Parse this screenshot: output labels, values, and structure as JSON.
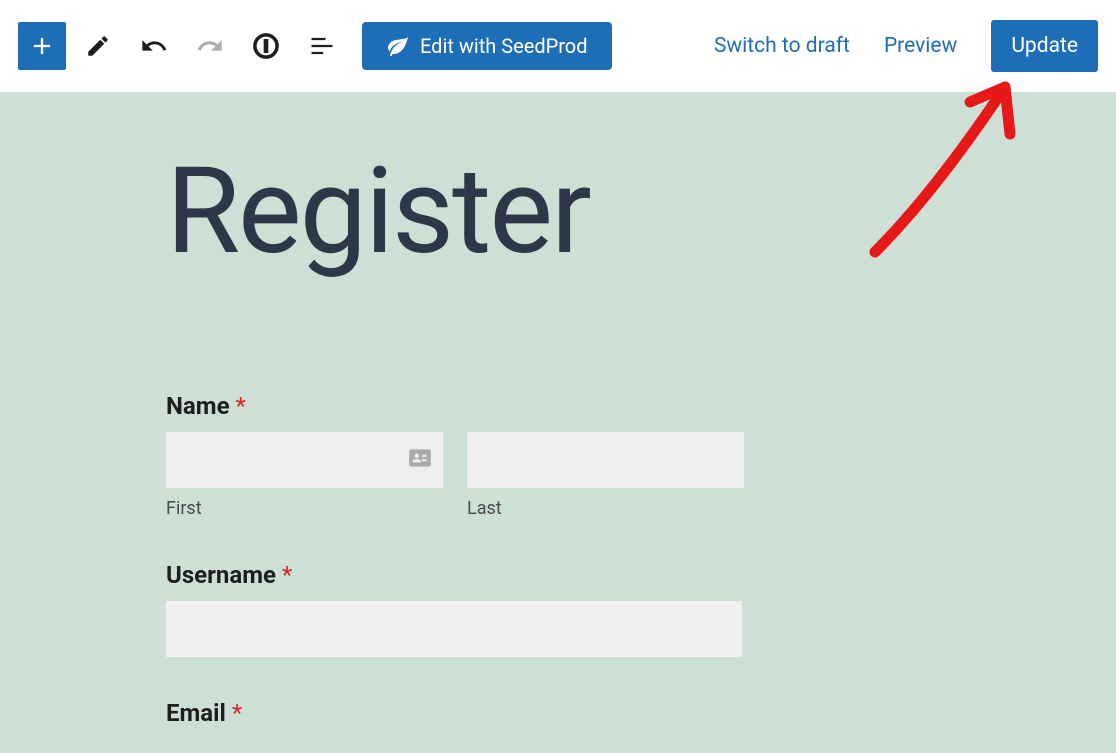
{
  "toolbar": {
    "seedprod_label": "Edit with SeedProd"
  },
  "header_actions": {
    "switch_to_draft": "Switch to draft",
    "preview": "Preview",
    "update": "Update"
  },
  "page": {
    "title": "Register"
  },
  "form": {
    "name": {
      "label": "Name",
      "required_mark": "*",
      "first_sublabel": "First",
      "last_sublabel": "Last"
    },
    "username": {
      "label": "Username",
      "required_mark": "*"
    },
    "email": {
      "label": "Email",
      "required_mark": "*"
    }
  }
}
